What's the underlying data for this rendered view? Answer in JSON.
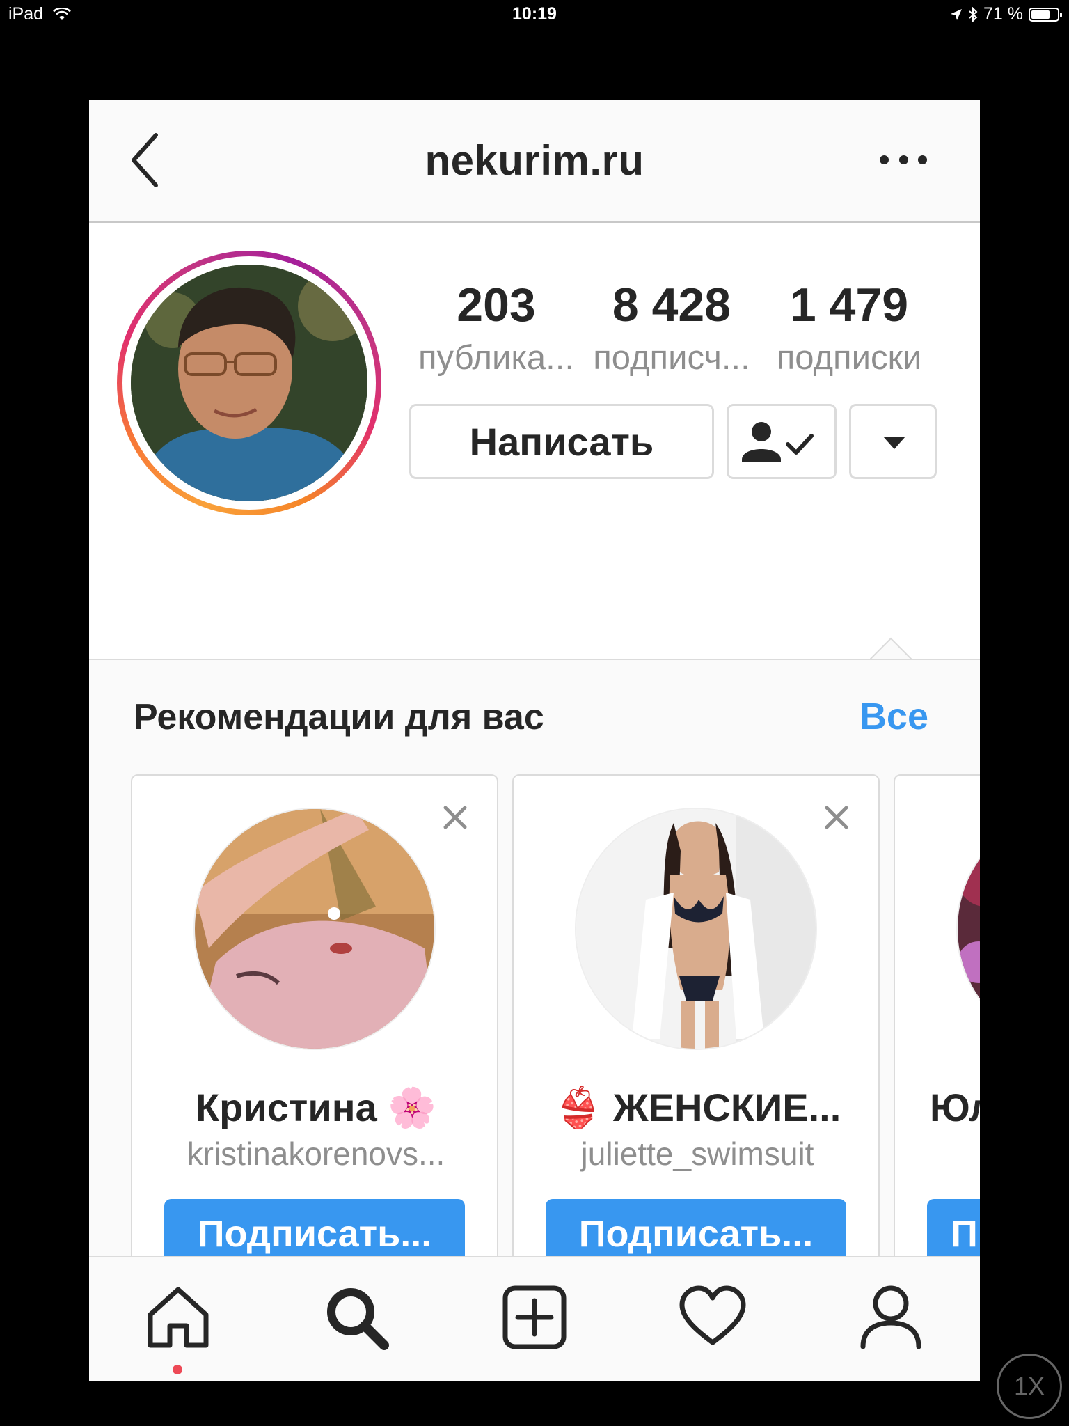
{
  "status_bar": {
    "device": "iPad",
    "time": "10:19",
    "battery": "71 %",
    "battery_level": 0.71
  },
  "nav": {
    "title": "nekurim.ru",
    "back_icon": "chevron-left-icon",
    "more_icon": "more-horizontal-icon"
  },
  "profile": {
    "stats": [
      {
        "value": "203",
        "label": "публика..."
      },
      {
        "value": "8 428",
        "label": "подписч..."
      },
      {
        "value": "1 479",
        "label": "подписки"
      }
    ],
    "message_button": "Написать",
    "following_icon": "user-check-icon",
    "dropdown_icon": "triangle-down-icon",
    "ring_colors": [
      "#f58529",
      "#e1306c",
      "#c13584"
    ]
  },
  "suggestions": {
    "title": "Рекомендации для вас",
    "see_all": "Все",
    "cards": [
      {
        "name": "Кристина 🌸",
        "username": "kristinakorenovs...",
        "button": "Подписать..."
      },
      {
        "name": "👙 ЖЕНСКИЕ...",
        "username": "juliette_swimsuit",
        "button": "Подписать..."
      },
      {
        "name": "Юл",
        "username": "",
        "button": "П"
      }
    ]
  },
  "tab_bar": {
    "items": [
      "home-icon",
      "search-icon",
      "add-post-icon",
      "heart-icon",
      "profile-icon"
    ],
    "active": "search-icon"
  },
  "zoom_button": "1X",
  "colors": {
    "accent_blue": "#3897f0",
    "text_primary": "#262626",
    "text_secondary": "#8e8e8e",
    "notification_red": "#ed4956"
  }
}
